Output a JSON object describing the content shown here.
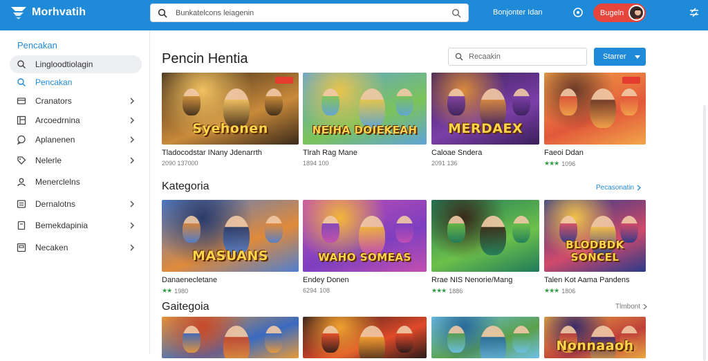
{
  "topbar": {
    "logo_text": "Morhvatih",
    "search_text": "Bunkatelcons leiagenin",
    "link_text": "Bonjonter Idan",
    "button_label": "Bugeln",
    "icons": [
      "logo-icon",
      "search-icon",
      "search-clear-icon",
      "record-icon",
      "settings-sliders-icon"
    ]
  },
  "sidebar": {
    "heading": "Pencakan",
    "items": [
      {
        "label": "Lingloodtiolagin",
        "icon": "search-icon",
        "chevron": false,
        "state": "selected"
      },
      {
        "label": "Pencakan",
        "icon": "search-icon",
        "chevron": false,
        "state": "active"
      },
      {
        "label": "Cranators",
        "icon": "card-icon",
        "chevron": true
      },
      {
        "label": "Arcoedrnina",
        "icon": "grid-icon",
        "chevron": true
      },
      {
        "label": "Aplanenen",
        "icon": "chat-icon",
        "chevron": true
      },
      {
        "label": "Nelerle",
        "icon": "tag-icon",
        "chevron": true
      },
      {
        "label": "Menerclelns",
        "icon": "user-icon",
        "chevron": false
      },
      {
        "label": "Dernalotns",
        "icon": "list-icon",
        "chevron": true
      },
      {
        "label": "Bemekdapinia",
        "icon": "doc-icon",
        "chevron": true
      },
      {
        "label": "Necaken",
        "icon": "box-icon",
        "chevron": true
      }
    ]
  },
  "main": {
    "title": "Pencin Hentia",
    "filter_placeholder": "Recaakin",
    "sort_label": "Starrer",
    "sections": [
      {
        "title": "",
        "link": "",
        "cards": [
          {
            "thumb_text": "Syehonen",
            "title": "Tladocodstar INany Jdenarrth",
            "meta": "2090 137000",
            "stars": "",
            "colors": [
              "#3b2a1a",
              "#c98a3a",
              "#f0c060"
            ]
          },
          {
            "thumb_text": "NEIHA DOIEKEAH",
            "title": "Tlrah Rag Mane",
            "meta": "1894 100",
            "stars": "",
            "colors": [
              "#5ea3d8",
              "#7cc35a",
              "#e7c44d"
            ]
          },
          {
            "thumb_text": "MERDAEX",
            "title": "Caloae Sndera",
            "meta": "2091 136",
            "stars": "",
            "colors": [
              "#3a1f5a",
              "#7b3fa8",
              "#d88a3a"
            ]
          },
          {
            "thumb_text": "",
            "title": "Faeoi Ddan",
            "meta": "1096",
            "stars": "★★★",
            "colors": [
              "#f2a64a",
              "#e2583a",
              "#6b3a28"
            ]
          }
        ]
      },
      {
        "title": "Kategoria",
        "link": "Pecasonatin",
        "cards": [
          {
            "thumb_text": "MASUANS",
            "title": "Danaenecletane",
            "meta": "1980",
            "stars": "★★",
            "colors": [
              "#4f7fd0",
              "#e08a3a",
              "#2a3b6a"
            ]
          },
          {
            "thumb_text": "WAHO SOMEAS",
            "title": "Endey Donen",
            "meta": "108",
            "stars": "6294",
            "colors": [
              "#c44fb0",
              "#7d3fc0",
              "#f2b63a"
            ]
          },
          {
            "thumb_text": "",
            "title": "Rrae NIS Nenorie/Mang",
            "meta": "1886",
            "stars": "★★★",
            "colors": [
              "#1f7a5a",
              "#6cc04a",
              "#3a2a1a"
            ]
          },
          {
            "thumb_text": "BLODBDK SONCEL",
            "title": "Talen Kot Aama Pandens",
            "meta": "1806",
            "stars": "★★★",
            "colors": [
              "#2a3a8a",
              "#d04a6a",
              "#f2c24a"
            ]
          }
        ]
      },
      {
        "title": "Gaitegoia",
        "link": "Tlmbont",
        "cards": [
          {
            "thumb_text": "",
            "title": "",
            "meta": "",
            "stars": "",
            "colors": [
              "#e89a3a",
              "#3a6ac0",
              "#c84a2a"
            ]
          },
          {
            "thumb_text": "",
            "title": "",
            "meta": "",
            "stars": "",
            "colors": [
              "#2a1a1a",
              "#e04a2a",
              "#f0a030"
            ]
          },
          {
            "thumb_text": "",
            "title": "",
            "meta": "",
            "stars": "",
            "colors": [
              "#6ec0e8",
              "#5aa04a",
              "#2a6a9a"
            ]
          },
          {
            "thumb_text": "Nonnaaoh",
            "title": "",
            "meta": "",
            "stars": "",
            "colors": [
              "#e8a840",
              "#c0403a",
              "#3a2a6a"
            ]
          }
        ]
      }
    ]
  },
  "colors": {
    "brand": "#1f8ad8",
    "danger": "#e5453b",
    "star": "#2e9e44"
  }
}
